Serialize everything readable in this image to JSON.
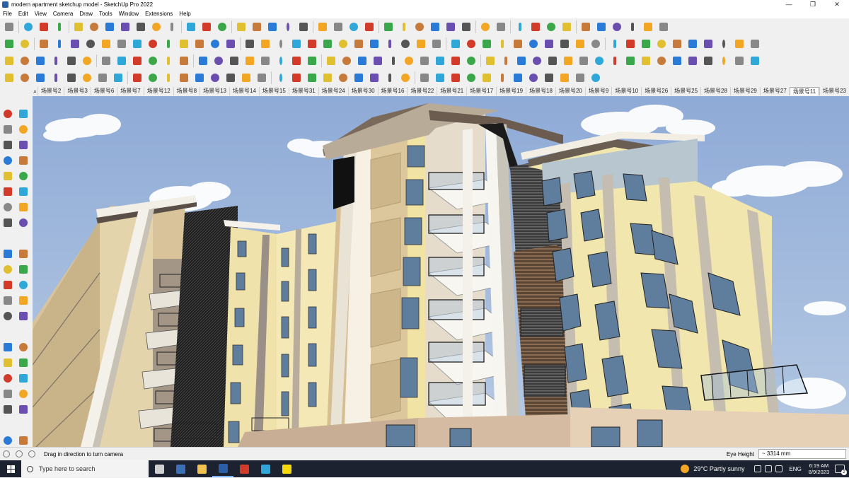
{
  "window": {
    "title": "modern apartment sketchup model - SketchUp Pro 2022",
    "minimize": "—",
    "restore": "❐",
    "close": "✕"
  },
  "menu": [
    "File",
    "Edit",
    "View",
    "Camera",
    "Draw",
    "Tools",
    "Window",
    "Extensions",
    "Help"
  ],
  "scenes": {
    "search_icon": "search-icon",
    "tabs": [
      "场景号2",
      "场景号3",
      "场景号6",
      "场景号7",
      "场景号12",
      "场景号8",
      "场景号13",
      "场景号14",
      "场景号15",
      "场景号31",
      "场景号24",
      "场景号30",
      "场景号16",
      "场景号22",
      "场景号21",
      "场景号17",
      "场景号19",
      "场景号18",
      "场景号20",
      "场景号9",
      "场景号10",
      "场景号26",
      "场景号25",
      "场景号28",
      "场景号29",
      "场景号27",
      "场景号11",
      "场景号23"
    ],
    "active": "场景号11"
  },
  "status": {
    "hint": "Drag in direction to turn camera",
    "vcb_label": "Eye Height",
    "vcb_value": "~ 3314 mm"
  },
  "taskbar": {
    "search_placeholder": "Type here to search",
    "weather": "29°C  Partly sunny",
    "lang": "ENG",
    "time": "6:19 AM",
    "date": "8/9/2023"
  },
  "colors": {
    "sky": "#9fb8dc",
    "facade_cream": "#f3e6ad",
    "facade_tan": "#d6c29b",
    "facade_dark": "#6a5d52",
    "accent_red": "#d23a2a"
  }
}
